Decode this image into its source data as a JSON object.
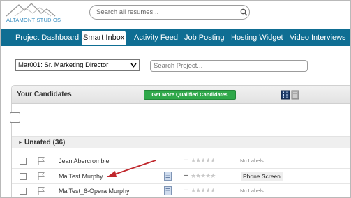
{
  "header": {
    "logo_text": "ALTAMONT STUDIOS",
    "search_placeholder": "Search all resumes..."
  },
  "nav": {
    "items": [
      {
        "label": "Project Dashboard",
        "active": false
      },
      {
        "label": "Smart Inbox",
        "active": true
      },
      {
        "label": "Activity Feed",
        "active": false
      },
      {
        "label": "Job Posting",
        "active": false
      },
      {
        "label": "Hosting Widget",
        "active": false
      },
      {
        "label": "Video Interviews",
        "active": false
      }
    ]
  },
  "project": {
    "selected": "Mar001: Sr. Marketing Director",
    "search_placeholder": "Search Project..."
  },
  "candidates": {
    "title": "Your Candidates",
    "more_button": "Get More Qualified Candidates",
    "group_label": "Unrated (36)",
    "rows": [
      {
        "name": "Jean Abercrombie",
        "has_resume": false,
        "label": "No Labels",
        "label_set": false
      },
      {
        "name": "MalTest Murphy",
        "has_resume": true,
        "label": "Phone Screen",
        "label_set": true
      },
      {
        "name": "MalTest_6-Opera Murphy",
        "has_resume": true,
        "label": "No Labels",
        "label_set": false
      }
    ]
  },
  "colors": {
    "nav_bg": "#0f6e93",
    "accent_green": "#2fa84a",
    "arrow_red": "#c0272d"
  }
}
